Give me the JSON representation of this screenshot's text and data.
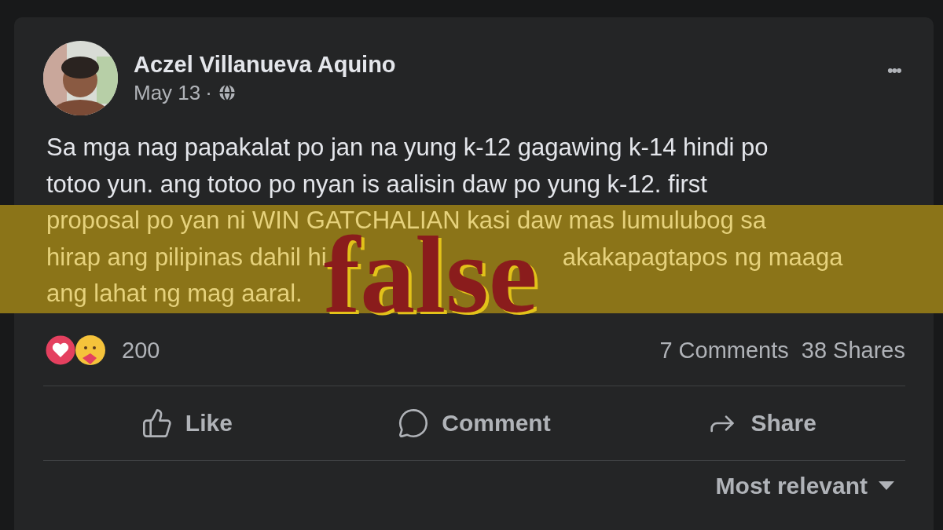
{
  "post": {
    "author": "Aczel Villanueva Aquino",
    "date": "May 13",
    "separator": "·",
    "more": "•••",
    "body_lines": [
      {
        "segments": [
          "Sa mga nag papakalat po jan na yung k-12 gagawing k-14 hindi po"
        ]
      },
      {
        "segments": [
          "totoo yun. ang totoo po nyan is aalisin daw po yung k-12. first"
        ]
      }
    ],
    "reaction_count": "200",
    "comments": "7 Comments",
    "shares": "38 Shares"
  },
  "rating_banner": {
    "stamp": "false",
    "lines": [
      {
        "segments": [
          "proposal po yan ni WIN GATCHALIAN kasi daw mas lumulubog sa"
        ]
      },
      {
        "segments": [
          "hirap ang pilipinas dahil hi",
          "akakapagtapos ng maaga"
        ]
      },
      {
        "segments": [
          "ang lahat ng mag aaral."
        ]
      }
    ]
  },
  "actions": [
    {
      "kind": "like",
      "label": "Like"
    },
    {
      "kind": "comment",
      "label": "Comment"
    },
    {
      "kind": "share",
      "label": "Share"
    }
  ],
  "sort": {
    "label": "Most relevant"
  }
}
